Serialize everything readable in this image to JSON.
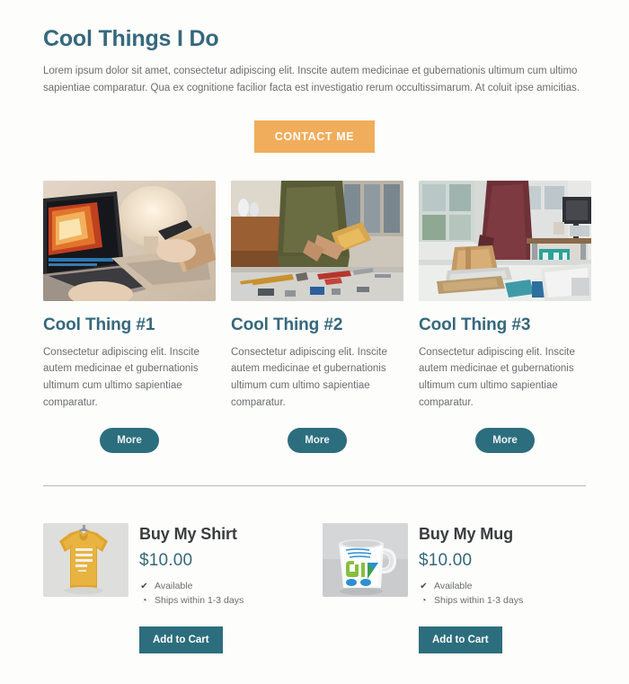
{
  "header": {
    "title": "Cool Things I Do",
    "intro": "Lorem ipsum dolor sit amet, consectetur adipiscing elit. Inscite autem medicinae et gubernationis ultimum cum ultimo sapientiae comparatur. Qua ex cognitione facilior facta est investigatio rerum occultissimarum. At coluit ipse amicitias."
  },
  "cta": {
    "contact_label": "CONTACT ME",
    "color": "#f0ad5b"
  },
  "cards": [
    {
      "title": "Cool Thing #1",
      "text": "Consectetur adipiscing elit. Inscite autem medicinae et gubernationis ultimum cum ultimo sapientiae comparatur.",
      "button_label": "More",
      "image_alt": "laptop-on-desk-photo"
    },
    {
      "title": "Cool Thing #2",
      "text": "Consectetur adipiscing elit. Inscite autem medicinae et gubernationis ultimum cum ultimo sapientiae comparatur.",
      "button_label": "More",
      "image_alt": "person-working-at-workbench-photo"
    },
    {
      "title": "Cool Thing #3",
      "text": "Consectetur adipiscing elit. Inscite autem medicinae et gubernationis ultimum cum ultimo sapientiae comparatur.",
      "button_label": "More",
      "image_alt": "person-packing-box-in-office-photo"
    }
  ],
  "products": [
    {
      "title": "Buy My Shirt",
      "price": "$10.00",
      "availability": "Available",
      "shipping": "Ships within 1-3 days",
      "button_label": "Add to Cart",
      "availability_icon": "check-icon",
      "shipping_icon": "clock-icon",
      "image_alt": "yellow-tshirt-photo"
    },
    {
      "title": "Buy My Mug",
      "price": "$10.00",
      "availability": "Available",
      "shipping": "Ships within 1-3 days",
      "button_label": "Add to Cart",
      "availability_icon": "check-icon",
      "shipping_icon": "clock-icon",
      "image_alt": "white-mug-with-logo-photo"
    }
  ],
  "icons": {
    "check": "✔",
    "clock": "◔"
  },
  "colors": {
    "accent_blue": "#35687d",
    "teal_button": "#2c6e7e",
    "orange_button": "#f0ad5b",
    "body_text": "#6a6d6f",
    "divider": "#aebcc2",
    "background": "#fdfdfb"
  }
}
